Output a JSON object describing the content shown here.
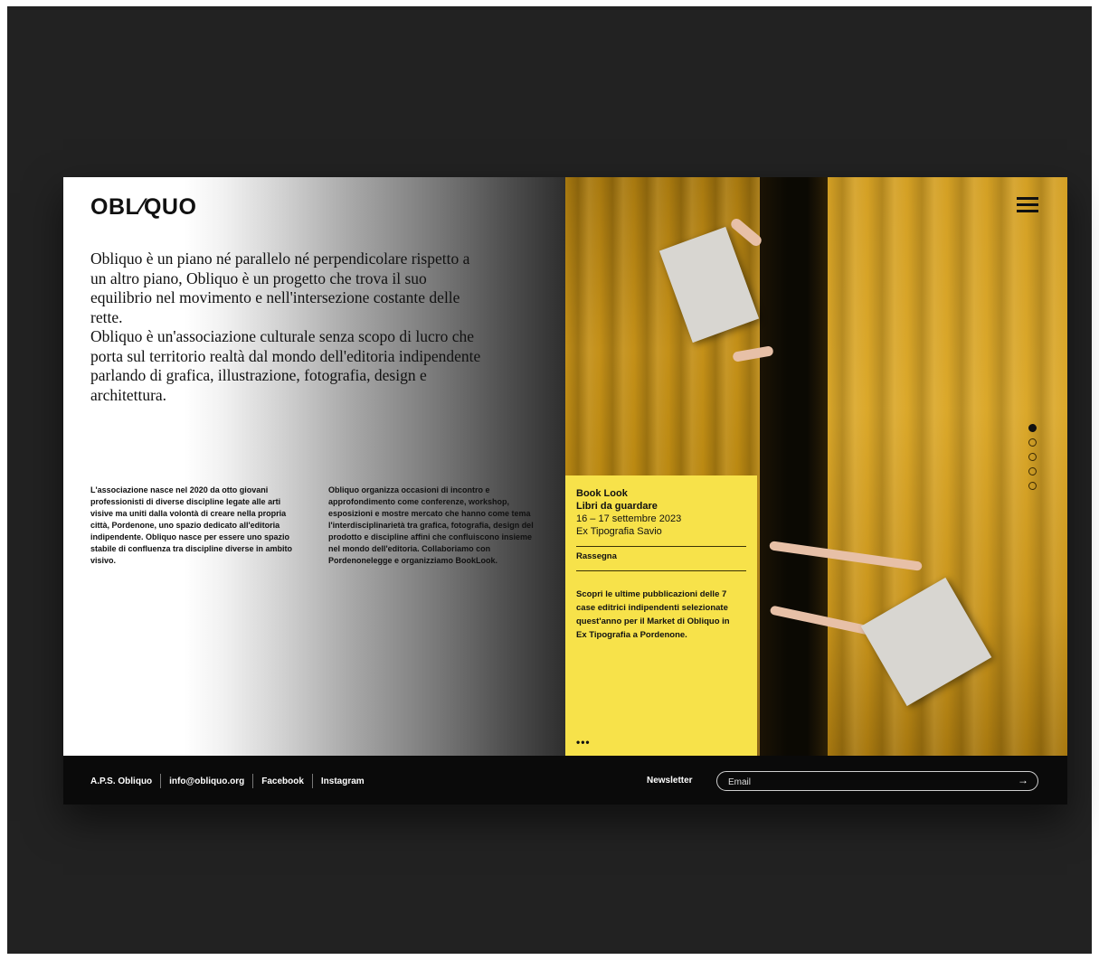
{
  "brand": {
    "logo_text": "OBL⁄QUO"
  },
  "intro": {
    "paragraph_1": "Obliquo è un piano né parallelo né perpendicolare rispetto a un altro piano, Obliquo è un progetto che trova il suo equilibrio nel movimento e nell'intersezione costante delle rette.",
    "paragraph_2": "Obliquo è un'associazione culturale senza scopo di lucro che porta sul territorio realtà dal mondo dell'editoria indipendente parlando di grafica, illustrazione, fotografia, design e architettura."
  },
  "columns": {
    "col1": "L'associazione nasce nel 2020 da otto giovani professionisti di diverse discipline legate alle arti visive ma uniti dalla volontà di creare nella propria città, Pordenone, uno spazio dedicato all'editoria indipendente. Obliquo nasce per essere uno spazio stabile di confluenza tra discipline diverse in ambito visivo.",
    "col2": "Obliquo organizza occasioni di incontro e approfondimento come conferenze, workshop, esposizioni e mostre mercato che hanno come tema l'interdisciplinarietà tra grafica, fotografia, design del prodotto e discipline affini che confluiscono insieme nel mondo dell'editoria. Collaboriamo con Pordenonelegge e organizziamo BookLook."
  },
  "event_card": {
    "title": "Book Look",
    "subtitle": "Libri da guardare",
    "dates": "16 – 17 settembre 2023",
    "venue": "Ex Tipografia Savio",
    "tag": "Rassegna",
    "description": "Scopri le ultime pubblicazioni delle 7 case editrici indipendenti selezionate quest'anno per il Market di Obliquo in Ex Tipografia a Pordenone.",
    "more": "•••",
    "background": "#f7e24a"
  },
  "slider": {
    "count": 5,
    "active_index": 0
  },
  "footer": {
    "links": [
      "A.P.S. Obliquo",
      "info@obliquo.org",
      "Facebook",
      "Instagram"
    ],
    "newsletter_label": "Newsletter",
    "email_placeholder": "Email",
    "submit_icon": "arrow-right-icon"
  },
  "colors": {
    "frame": "#222222",
    "footer": "#0a0a0a",
    "accent_yellow": "#f7e24a"
  }
}
